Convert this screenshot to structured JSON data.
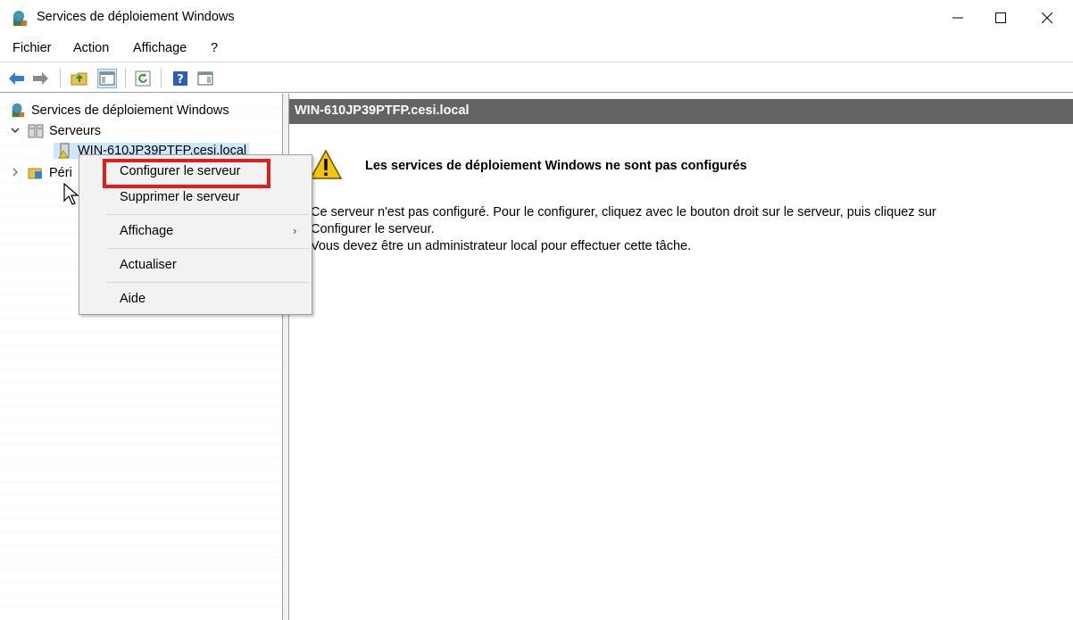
{
  "window": {
    "title": "Services de déploiement Windows",
    "controls": {
      "minimize": "—",
      "maximize": "☐",
      "close": "✕"
    }
  },
  "menubar": {
    "items": [
      "Fichier",
      "Action",
      "Affichage",
      "?"
    ]
  },
  "toolbar": {
    "icons": [
      "back-arrow-icon",
      "forward-arrow-icon",
      "up-folder-icon",
      "show-hide-tree-icon",
      "refresh-icon",
      "help-icon",
      "action-pane-icon"
    ]
  },
  "tree": {
    "root": "Services de déploiement Windows",
    "servers": "Serveurs",
    "server_node": "WIN-610JP39PTFP.cesi.local",
    "devices_node": "Péri"
  },
  "right_pane": {
    "header": "WIN-610JP39PTFP.cesi.local",
    "notice_title": "Les services de déploiement Windows ne sont pas configurés",
    "notice_line1": "Ce serveur n'est pas configuré. Pour le configurer, cliquez avec le bouton droit sur le serveur, puis cliquez sur",
    "notice_line2": "Configurer le serveur.",
    "notice_line3": "Vous devez être un administrateur local pour effectuer cette tâche."
  },
  "context_menu": {
    "configure": "Configurer le serveur",
    "remove": "Supprimer le serveur",
    "view": "Affichage",
    "refresh": "Actualiser",
    "help": "Aide",
    "submenu_arrow": "›"
  },
  "colors": {
    "highlight": "#e51a1a",
    "header_band": "#646464",
    "selection": "#cce8ff"
  }
}
